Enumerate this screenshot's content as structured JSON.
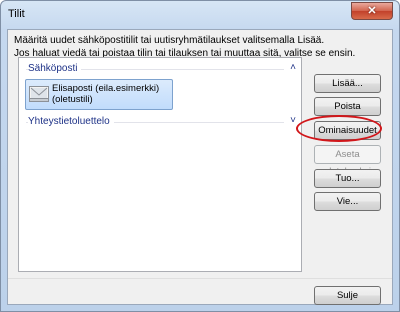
{
  "window": {
    "title": "Tilit"
  },
  "description": {
    "line1": "Määritä uudet sähköpostitilit tai uutisryhmätilaukset valitsemalla Lisää.",
    "line2": "Jos haluat viedä tai poistaa tilin tai tilauksen tai muuttaa sitä, valitse se ensin."
  },
  "list": {
    "groups": [
      {
        "label": "Sähköposti",
        "chevron": "˄",
        "items": [
          {
            "line1": "Elisaposti (eila.esimerkki)",
            "line2": "(oletustili)"
          }
        ]
      },
      {
        "label": "Yhteystietoluettelo",
        "chevron": "˅"
      }
    ]
  },
  "buttons": {
    "add": "Lisää...",
    "remove": "Poista",
    "properties": "Ominaisuudet",
    "set_default": "Aseta oletukseksi",
    "import": "Tuo...",
    "export": "Vie...",
    "close": "Sulje"
  },
  "colors": {
    "highlight_ellipse": "#d1161a",
    "group_header": "#1e3287",
    "selection": "#c1dcfc"
  },
  "icons": {
    "account": "mail-account-icon",
    "close": "close-icon"
  }
}
